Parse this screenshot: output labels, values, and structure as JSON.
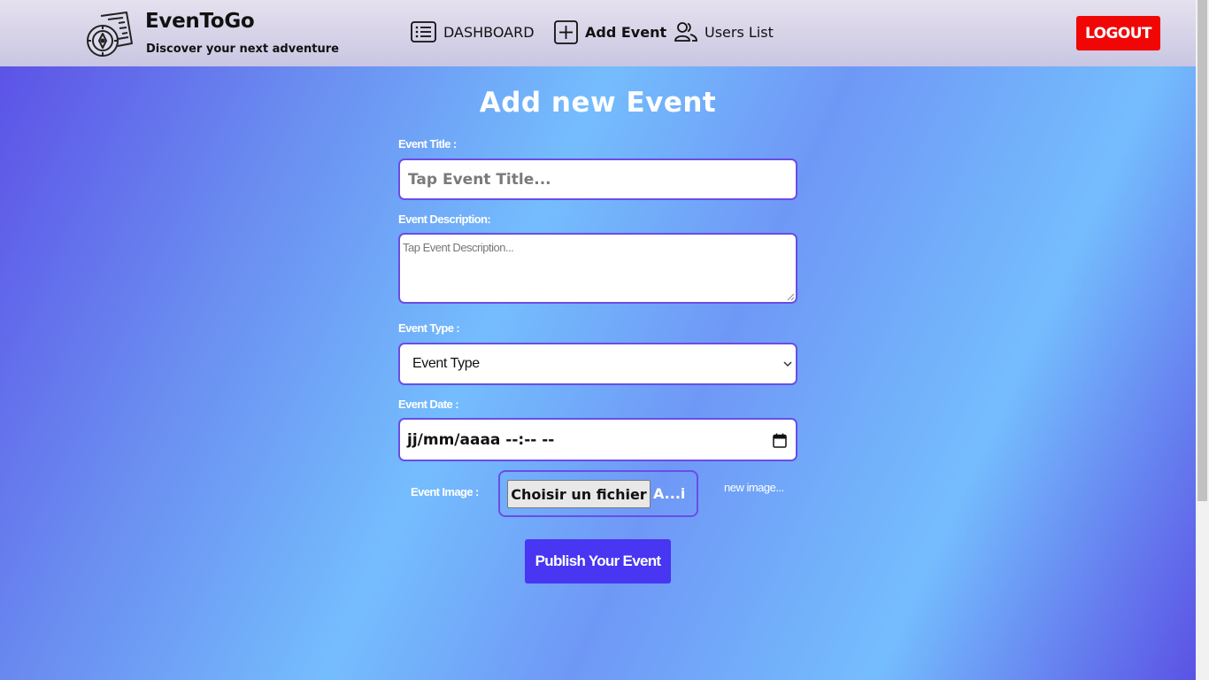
{
  "header": {
    "brand_name": "EvenToGo",
    "tagline": "Discover your next adventure",
    "nav": [
      {
        "label": "DASHBOARD",
        "icon": "list-icon"
      },
      {
        "label": "Add Event",
        "icon": "plus-square-icon"
      },
      {
        "label": "Users List",
        "icon": "users-icon"
      }
    ],
    "logout_label": "LOGOUT"
  },
  "form": {
    "title": "Add new Event",
    "event_title_label": "Event Title :",
    "event_title_placeholder": "Tap Event Title...",
    "event_description_label": "Event Description:",
    "event_description_placeholder": "Tap Event Description...",
    "event_type_label": "Event Type :",
    "event_type_selected": "Event Type",
    "event_date_label": "Event Date :",
    "event_date_value": "jj/mm/aaaa --:-- --",
    "event_image_label": "Event Image :",
    "file_button_label": "Choisir un fichier",
    "file_name": "A...i",
    "new_image_text": "new image...",
    "publish_label": "Publish Your Event"
  },
  "colors": {
    "logout_bg": "#f10606",
    "publish_bg": "#4836f2",
    "input_border": "#6a4de6"
  }
}
